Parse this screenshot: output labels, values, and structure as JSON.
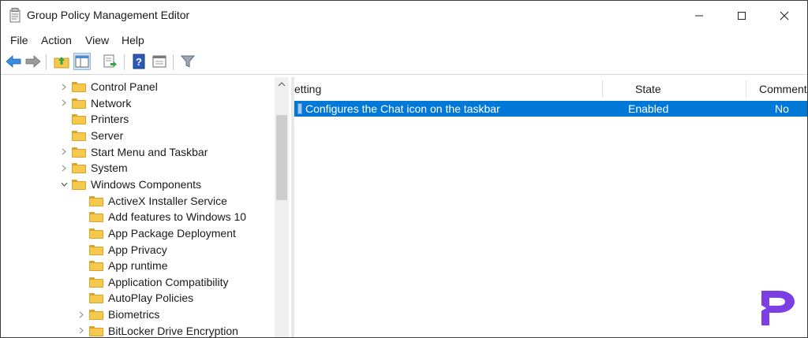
{
  "window": {
    "title": "Group Policy Management Editor"
  },
  "menu": {
    "items": [
      "File",
      "Action",
      "View",
      "Help"
    ]
  },
  "toolbar": {
    "buttons": [
      "back-icon",
      "forward-icon",
      "up-folder-icon",
      "show-hide-tree-icon",
      "export-list-icon",
      "help-icon",
      "properties-icon",
      "filter-icon"
    ]
  },
  "tree": {
    "items": [
      {
        "label": "Control Panel",
        "expander": "collapsed"
      },
      {
        "label": "Network",
        "expander": "collapsed"
      },
      {
        "label": "Printers",
        "expander": "none"
      },
      {
        "label": "Server",
        "expander": "none"
      },
      {
        "label": "Start Menu and Taskbar",
        "expander": "collapsed"
      },
      {
        "label": "System",
        "expander": "collapsed"
      },
      {
        "label": "Windows Components",
        "expander": "expanded"
      },
      {
        "label": "ActiveX Installer Service",
        "expander": "none"
      },
      {
        "label": "Add features to Windows 10",
        "expander": "none"
      },
      {
        "label": "App Package Deployment",
        "expander": "none"
      },
      {
        "label": "App Privacy",
        "expander": "none"
      },
      {
        "label": "App runtime",
        "expander": "none"
      },
      {
        "label": "Application Compatibility",
        "expander": "none"
      },
      {
        "label": "AutoPlay Policies",
        "expander": "none"
      },
      {
        "label": "Biometrics",
        "expander": "collapsed"
      },
      {
        "label": "BitLocker Drive Encryption",
        "expander": "collapsed"
      }
    ]
  },
  "list": {
    "columns": {
      "setting": "etting",
      "state": "State",
      "comment": "Comment"
    },
    "rows": [
      {
        "setting": "Configures the Chat icon on the taskbar",
        "state": "Enabled",
        "comment": "No",
        "selected": true
      }
    ]
  },
  "colors": {
    "selection": "#0078d7",
    "folder": "#f6c94c",
    "logo": "#7b3fe4"
  }
}
